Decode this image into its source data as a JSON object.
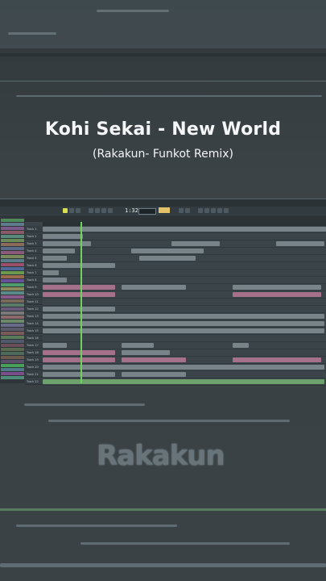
{
  "video": {
    "title": "Kohi Sekai - New World",
    "subtitle": "(Rakakun- Funkot Remix)"
  },
  "daw": {
    "tempo": "1:32:00",
    "pattern_label": "Pattern 1",
    "tracks": [
      "Track 1",
      "Track 2",
      "Track 3",
      "Track 4",
      "Track 5",
      "Track 6",
      "Track 7",
      "Track 8",
      "Track 9",
      "Track 10",
      "Track 11",
      "Track 12",
      "Track 13",
      "Track 14",
      "Track 15",
      "Track 16",
      "Track 17",
      "Track 18",
      "Track 19",
      "Track 20",
      "Track 21",
      "Track 22"
    ]
  },
  "watermark": {
    "logo_text": "Rakakun"
  },
  "colors": {
    "background": "#3a4145",
    "title_text": "#f4f6f7",
    "playhead": "#6fd25d",
    "clip_pink": "#c97fa0",
    "clip_gray": "#8d9aa0",
    "clip_green": "#7fc27a"
  }
}
